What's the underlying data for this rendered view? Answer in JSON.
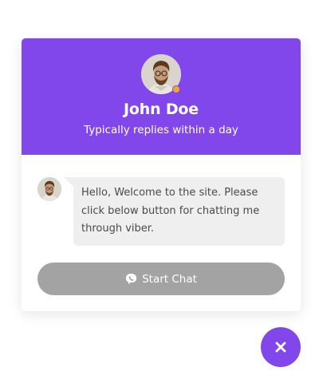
{
  "header": {
    "name": "John Doe",
    "status": "Typically replies within a day",
    "status_dot_color": "#f6a623",
    "background_color": "#8247ea"
  },
  "message": {
    "text": "Hello, Welcome to the site. Please click below button for chatting me through viber."
  },
  "start_button": {
    "label": "Start Chat",
    "icon": "viber-icon",
    "color": "#a3a3a3"
  },
  "close_button": {
    "icon": "close-icon",
    "color": "#8247ea"
  }
}
